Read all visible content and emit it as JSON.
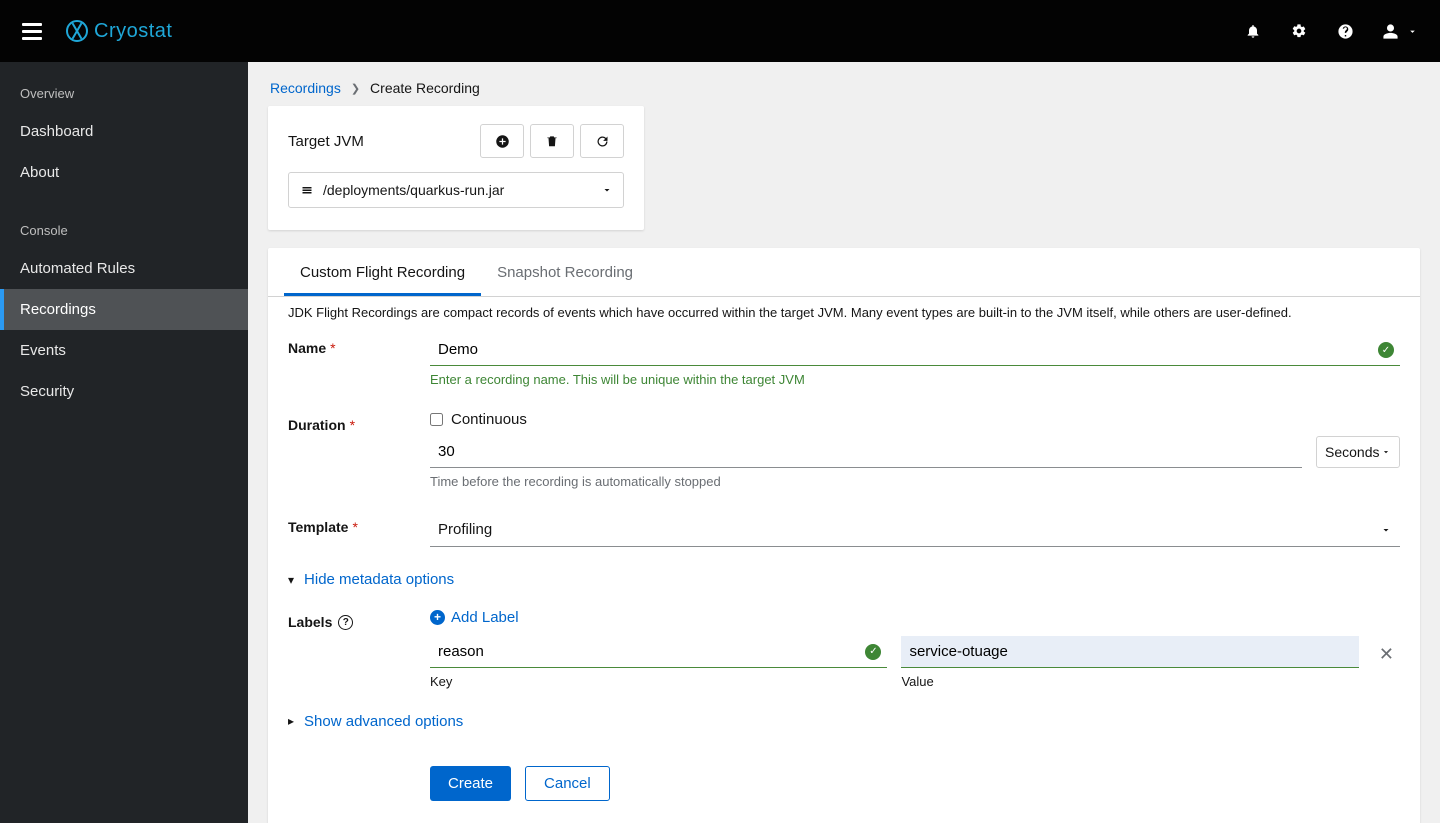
{
  "brand": {
    "name": "Cryostat"
  },
  "topbar": {
    "bell": "notifications-icon",
    "gear": "settings-icon",
    "help": "help-icon",
    "user": "user-menu"
  },
  "sidebar": {
    "sections": [
      {
        "title": "Overview",
        "items": [
          "Dashboard",
          "About"
        ]
      },
      {
        "title": "Console",
        "items": [
          "Automated Rules",
          "Recordings",
          "Events",
          "Security"
        ]
      }
    ],
    "active": "Recordings"
  },
  "breadcrumb": {
    "parent": "Recordings",
    "current": "Create Recording"
  },
  "target_card": {
    "title": "Target JVM",
    "selected": "/deployments/quarkus-run.jar"
  },
  "tabs": {
    "items": [
      "Custom Flight Recording",
      "Snapshot Recording"
    ],
    "active": 0
  },
  "description": "JDK Flight Recordings are compact records of events which have occurred within the target JVM. Many event types are built-in to the JVM itself, while others are user-defined.",
  "form": {
    "name": {
      "label": "Name",
      "value": "Demo",
      "helper": "Enter a recording name. This will be unique within the target JVM"
    },
    "duration": {
      "label": "Duration",
      "continuous_label": "Continuous",
      "continuous_checked": false,
      "value": "30",
      "unit": "Seconds",
      "helper": "Time before the recording is automatically stopped"
    },
    "template": {
      "label": "Template",
      "value": "Profiling"
    },
    "metadata_toggle": "Hide metadata options",
    "labels": {
      "label": "Labels",
      "add": "Add Label",
      "rows": [
        {
          "key": "reason",
          "value": "service-otuage"
        }
      ],
      "key_label": "Key",
      "value_label": "Value"
    },
    "advanced_toggle": "Show advanced options",
    "actions": {
      "create": "Create",
      "cancel": "Cancel"
    }
  }
}
